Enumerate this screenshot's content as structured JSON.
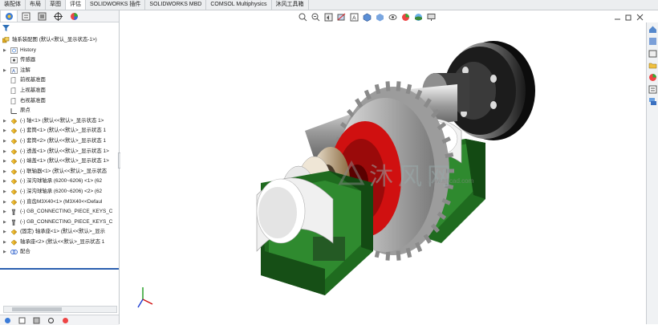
{
  "tabs": [
    {
      "label": "装配体",
      "active": false
    },
    {
      "label": "布局",
      "active": false
    },
    {
      "label": "草图",
      "active": false
    },
    {
      "label": "评估",
      "active": true
    },
    {
      "label": "SOLIDWORKS 插件",
      "active": false
    },
    {
      "label": "SOLIDWORKS MBD",
      "active": false
    },
    {
      "label": "COMSOL Multiphysics",
      "active": false
    },
    {
      "label": "沐风工具箱",
      "active": false
    }
  ],
  "tree": {
    "root": "轴系装配图 (默认<默认_显示状态-1>)",
    "items": [
      {
        "label": "History",
        "icon": "history-icon",
        "expand": true,
        "indent": 1
      },
      {
        "label": "传感器",
        "icon": "sensor-icon",
        "expand": false,
        "indent": 1
      },
      {
        "label": "注解",
        "icon": "annotation-icon",
        "expand": true,
        "indent": 1
      },
      {
        "label": "前视基准面",
        "icon": "plane-icon",
        "expand": false,
        "indent": 1
      },
      {
        "label": "上视基准面",
        "icon": "plane-icon",
        "expand": false,
        "indent": 1
      },
      {
        "label": "右视基准面",
        "icon": "plane-icon",
        "expand": false,
        "indent": 1
      },
      {
        "label": "原点",
        "icon": "origin-icon",
        "expand": false,
        "indent": 1
      },
      {
        "label": "(-) 轴<1> (默认<<默认>_显示状态 1>",
        "icon": "part-icon",
        "expand": true,
        "indent": 1
      },
      {
        "label": "(-) 套筒<1> (默认<<默认>_显示状态 1",
        "icon": "part-icon",
        "expand": true,
        "indent": 1
      },
      {
        "label": "(-) 套筒<2> (默认<<默认>_显示状态 1",
        "icon": "part-icon",
        "expand": true,
        "indent": 1
      },
      {
        "label": "(-) 透盖<1> (默认<<默认>_显示状态 1>",
        "icon": "part-icon",
        "expand": true,
        "indent": 1
      },
      {
        "label": "(-) 端盖<1> (默认<<默认>_显示状态 1>",
        "icon": "part-icon",
        "expand": true,
        "indent": 1
      },
      {
        "label": "(-) 联轴器<1> (默认<<默认>_显示状态",
        "icon": "part-icon",
        "expand": true,
        "indent": 1
      },
      {
        "label": "(-) 深沟球轴承 (6200~6206) <1> (62",
        "icon": "part-icon",
        "expand": true,
        "indent": 1
      },
      {
        "label": "(-) 深沟球轴承 (6200~6206) <2> (62",
        "icon": "part-icon",
        "expand": true,
        "indent": 1
      },
      {
        "label": "(-) 直齿M3X40<1> (M3X40<<Defaul",
        "icon": "part-icon",
        "expand": true,
        "indent": 1
      },
      {
        "label": "(-) GB_CONNECTING_PIECE_KEYS_C",
        "icon": "toolbox-icon",
        "expand": true,
        "indent": 1
      },
      {
        "label": "(-) GB_CONNECTING_PIECE_KEYS_C",
        "icon": "toolbox-icon",
        "expand": true,
        "indent": 1
      },
      {
        "label": "(固定) 轴承座<1> (默认<<默认>_显示",
        "icon": "part-icon",
        "expand": true,
        "indent": 1
      },
      {
        "label": "轴承座<2> (默认<<默认>_显示状态 1",
        "icon": "part-icon",
        "expand": true,
        "indent": 1
      },
      {
        "label": "配合",
        "icon": "mates-icon",
        "expand": true,
        "indent": 1
      }
    ]
  },
  "watermark": {
    "text": "沐风网",
    "sub": "www.mfcad.com"
  },
  "colors": {
    "accent": "#2b5fb0",
    "green": "#1f6b1f",
    "red": "#d01010",
    "gear": "#b4b4b4"
  }
}
